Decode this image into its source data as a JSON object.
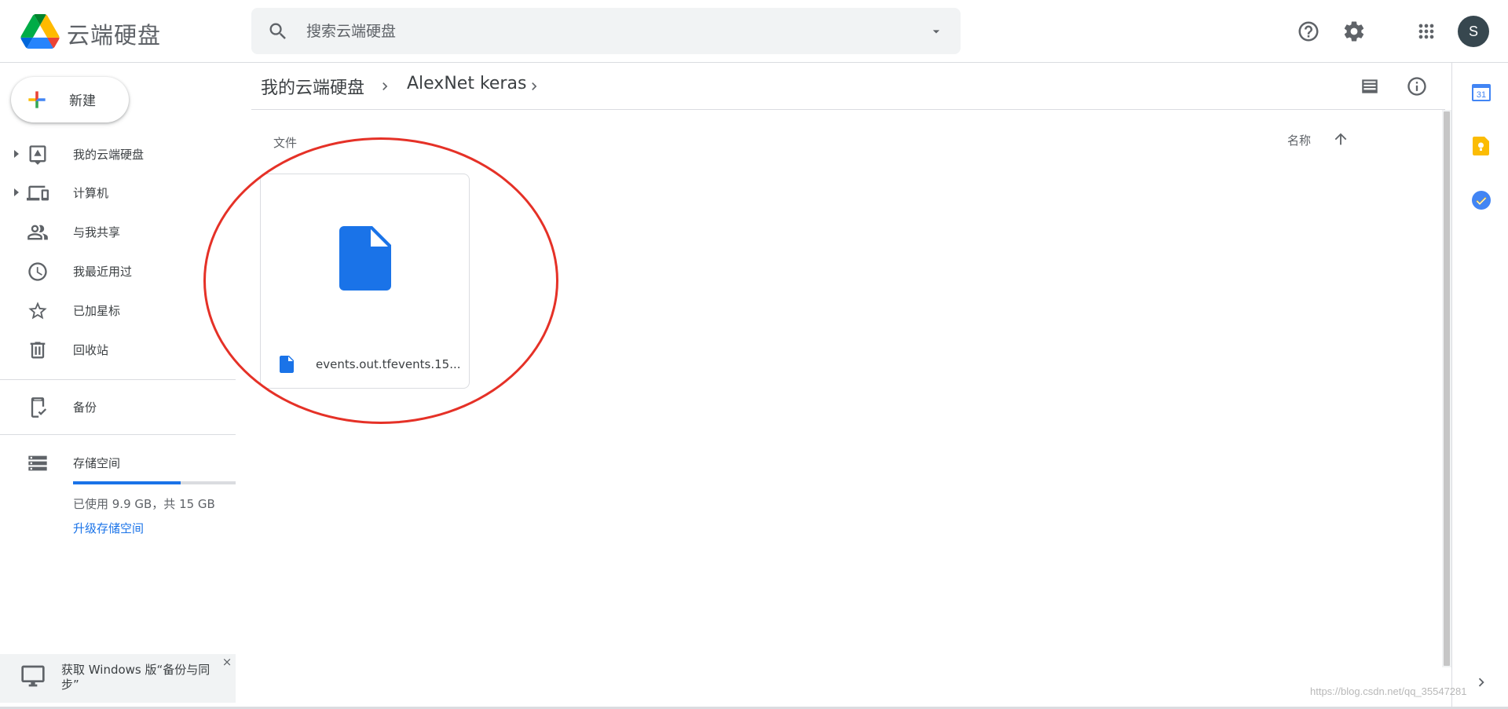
{
  "app": {
    "title": "云端硬盘"
  },
  "search": {
    "placeholder": "搜索云端硬盘"
  },
  "header": {
    "icons": [
      "help-icon",
      "settings-icon",
      "apps-grid-icon"
    ],
    "avatar_letter": "S"
  },
  "sidebar": {
    "new_label": "新建",
    "items": [
      {
        "label": "我的云端硬盘",
        "icon": "my-drive-icon",
        "expandable": true
      },
      {
        "label": "计算机",
        "icon": "computers-icon",
        "expandable": true
      },
      {
        "label": "与我共享",
        "icon": "shared-people-icon",
        "expandable": false
      },
      {
        "label": "我最近用过",
        "icon": "clock-icon",
        "expandable": false
      },
      {
        "label": "已加星标",
        "icon": "star-icon",
        "expandable": false
      },
      {
        "label": "回收站",
        "icon": "trash-icon",
        "expandable": false
      }
    ],
    "backup_label": "备份",
    "storage": {
      "label": "存储空间",
      "used_text": "已使用 9.9 GB，共 15 GB",
      "used_fraction": 0.66,
      "upgrade_label": "升级存储空间"
    },
    "promo": {
      "text": "获取 Windows 版“备份与同步”",
      "close": "×"
    }
  },
  "breadcrumb": [
    "我的云端硬盘",
    "AlexNet keras"
  ],
  "main": {
    "section_label": "文件",
    "sort_label": "名称",
    "sort_direction": "ascending",
    "files": [
      {
        "name": "events.out.tfevents.15...",
        "type": "generic-file",
        "icon_color": "#1a73e8"
      }
    ],
    "highlight_color": "#e53127"
  },
  "side_panel": {
    "icons": [
      "calendar-icon",
      "keep-icon",
      "tasks-icon"
    ],
    "calendar_day": "31"
  },
  "watermark": "https://blog.csdn.net/qq_35547281"
}
